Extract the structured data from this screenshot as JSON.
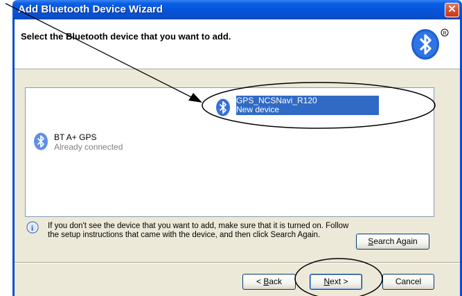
{
  "window": {
    "title": "Add Bluetooth Device Wizard",
    "close_icon": "close-icon"
  },
  "header": {
    "instruction": "Select the Bluetooth device that you want to add.",
    "logo_icon": "bluetooth-logo-icon"
  },
  "devices": [
    {
      "name": "GPS_NCSNavi_R120",
      "status": "New device",
      "selected": true,
      "icon": "bluetooth-icon"
    },
    {
      "name": "BT A+ GPS",
      "status": "Already connected",
      "selected": false,
      "icon": "bluetooth-icon"
    }
  ],
  "info": {
    "icon": "info-icon",
    "text": "If you don't see the device that you want to add, make sure that it is turned on. Follow the setup instructions that came with the device, and then click Search Again."
  },
  "buttons": {
    "search_again": {
      "mnemonic": "S",
      "rest": "earch Again"
    },
    "back": {
      "prefix": "< ",
      "mnemonic": "B",
      "rest": "ack"
    },
    "next": {
      "mnemonic": "N",
      "rest": "ext >"
    },
    "cancel": "Cancel"
  },
  "colors": {
    "title_bar": "#0553da",
    "selection": "#316ac5",
    "dialog_bg": "#ece9d8",
    "bluetooth": "#3a6fd8",
    "annotation": "#000000"
  }
}
